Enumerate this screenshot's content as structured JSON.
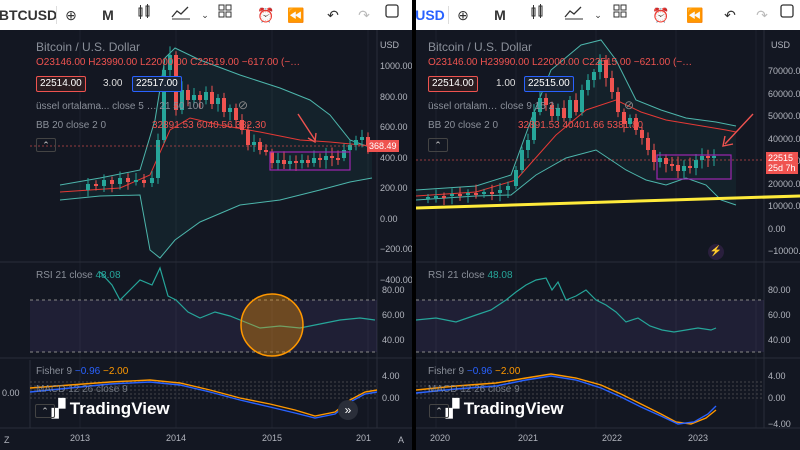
{
  "left": {
    "toolbar": {
      "symbol": "BTCUSD",
      "interval": "M"
    },
    "legend": {
      "title": "Bitcoin / U.S. Dollar",
      "open": "O23146.00",
      "high": "H23990.00",
      "low": "L22000.00",
      "close": "C22519.00",
      "change": "−617.00 (−…",
      "bid": "22514.00",
      "spread": "3.00",
      "ask": "22517.00",
      "ma": "üssel ortalama... close 5 … 21 50 100",
      "bb": "BB 20 close 2 0",
      "bb_vals": "32891.53  6040.56  382.30"
    },
    "price_axis": {
      "unit": "USD",
      "ticks": [
        "1000.00",
        "800.00",
        "600.00",
        "400.00",
        "200.00",
        "0.00",
        "−200.00",
        "−400.00"
      ],
      "last": "368.49"
    },
    "rsi": {
      "label": "RSI 21 close",
      "value": "48.08",
      "ticks": [
        "80.00",
        "60.00",
        "40.00"
      ]
    },
    "fisher": {
      "label": "Fisher 9",
      "v1": "−0.96",
      "v2": "−2.00",
      "ticks": [
        "4.00",
        "0.00"
      ]
    },
    "macd": {
      "label": "MACD 12 26 close 9"
    },
    "time_axis": [
      "2013",
      "2014",
      "2015",
      "201"
    ],
    "axis_left": "0.00",
    "brand": "TradingView"
  },
  "right": {
    "toolbar": {
      "symbol": "USD",
      "interval": "M"
    },
    "legend": {
      "title": "Bitcoin / U.S. Dollar",
      "open": "O23146.00",
      "high": "H23990.00",
      "low": "L22000.00",
      "close": "C22515.00",
      "change": "−621.00 (−…",
      "bid": "22514.00",
      "spread": "1.00",
      "ask": "22515.00",
      "ma": "üssel ortalam… close 9 15 2…",
      "bb": "BB 20 close 2 0",
      "bb_vals": "32891.53  40401.66  5381.80"
    },
    "price_axis": {
      "unit": "USD",
      "ticks": [
        "70000.00",
        "60000.00",
        "50000.00",
        "40000.00",
        "30000.00",
        "20000.00",
        "10000.00",
        "0.00",
        "−10000.00"
      ],
      "last": "22515",
      "countdown": "25d 7h"
    },
    "rsi": {
      "label": "RSI 21 close",
      "value": "48.08",
      "ticks": [
        "80.00",
        "60.00",
        "40.00"
      ]
    },
    "fisher": {
      "label": "Fisher 9",
      "v1": "−0.96",
      "v2": "−2.00",
      "ticks": [
        "4.00",
        "0.00",
        "−4.00"
      ]
    },
    "macd": {
      "label": "MACD 12 26 close 9"
    },
    "time_axis": [
      "2020",
      "2021",
      "2022",
      "2023"
    ],
    "brand": "TradingView"
  },
  "colors": {
    "bg": "#131722",
    "up": "#26a69a",
    "down": "#ef5350",
    "bb": "#4db6ac",
    "ma": "#e53935",
    "rsi": "#26a69a",
    "fisher_a": "#2962ff",
    "fisher_b": "#ff9800",
    "highlight": "#ffeb3b",
    "box": "#9c27b0"
  }
}
